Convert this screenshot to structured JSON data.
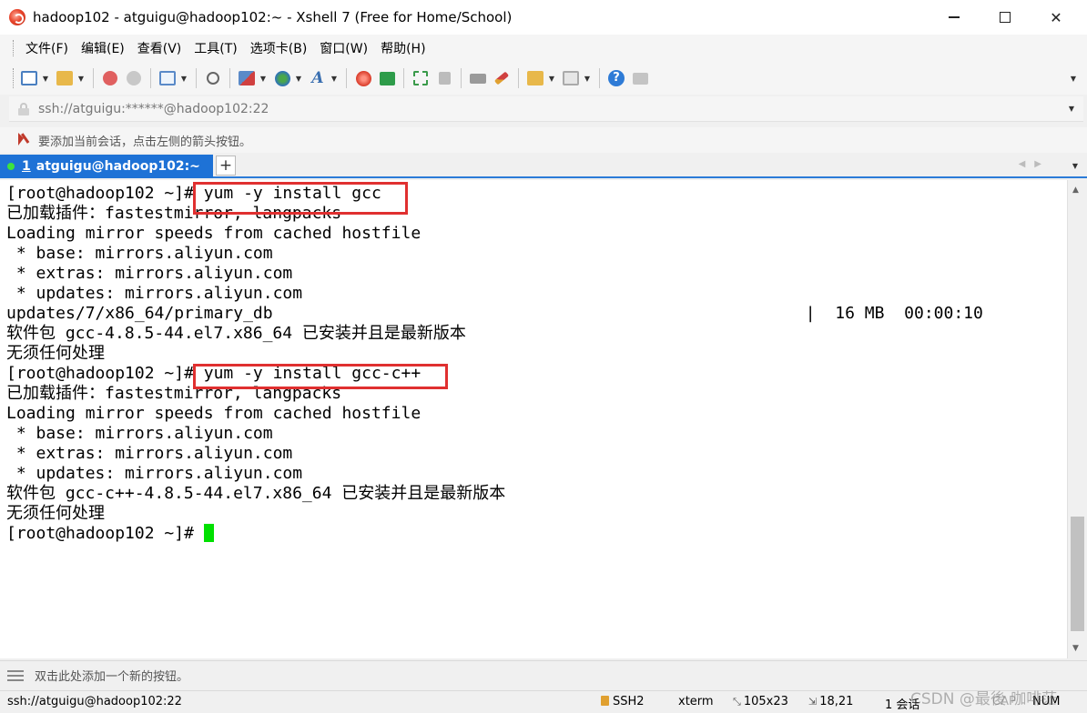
{
  "window": {
    "title": "hadoop102 - atguigu@hadoop102:~ - Xshell 7 (Free for Home/School)"
  },
  "menubar": {
    "items": [
      "文件(F)",
      "编辑(E)",
      "查看(V)",
      "工具(T)",
      "选项卡(B)",
      "窗口(W)",
      "帮助(H)"
    ]
  },
  "toolbar": {
    "icons": [
      "new-session-icon",
      "open-folder-icon",
      "reconnect-icon",
      "disconnect-icon",
      "properties-icon",
      "find-icon",
      "transfer-icon",
      "globe-icon",
      "font-icon",
      "xshell-icon",
      "xftp-icon",
      "fullscreen-icon",
      "lock-icon",
      "keyboard-icon",
      "highlight-icon",
      "new-tab-icon",
      "layout-icon",
      "help-icon",
      "chat-icon"
    ]
  },
  "address": {
    "value": "ssh://atguigu:******@hadoop102:22"
  },
  "hint": {
    "text": "要添加当前会话，点击左侧的箭头按钮。"
  },
  "tabs": [
    {
      "number": "1",
      "label": "atguigu@hadoop102:~",
      "active": true
    }
  ],
  "new_tab_label": "+",
  "terminal": {
    "lines": [
      "[root@hadoop102 ~]# yum -y install gcc",
      "已加载插件：fastestmirror, langpacks",
      "Loading mirror speeds from cached hostfile",
      " * base: mirrors.aliyun.com",
      " * extras: mirrors.aliyun.com",
      " * updates: mirrors.aliyun.com",
      "updates/7/x86_64/primary_db                                                      |  16 MB  00:00:10",
      "软件包 gcc-4.8.5-44.el7.x86_64 已安装并且是最新版本",
      "无须任何处理",
      "[root@hadoop102 ~]# yum -y install gcc-c++",
      "已加载插件：fastestmirror, langpacks",
      "Loading mirror speeds from cached hostfile",
      " * base: mirrors.aliyun.com",
      " * extras: mirrors.aliyun.com",
      " * updates: mirrors.aliyun.com",
      "软件包 gcc-c++-4.8.5-44.el7.x86_64 已安装并且是最新版本",
      "无须任何处理"
    ],
    "prompt": "[root@hadoop102 ~]# ",
    "cursor_color": "#00e000",
    "highlight_color": "#e03030"
  },
  "quickbar": {
    "text": "双击此处添加一个新的按钮。"
  },
  "statusbar": {
    "connection": "ssh://atguigu@hadoop102:22",
    "protocol": "SSH2",
    "terminal_type": "xterm",
    "size": "105x23",
    "position": "18,21",
    "sessions": "1 会话",
    "cap": "CAP",
    "num": "NUM"
  },
  "watermark": "CSDN @最後 咖啡茫",
  "colors": {
    "tab_active": "#1e72d6",
    "tab_status": "#3ee23e"
  }
}
